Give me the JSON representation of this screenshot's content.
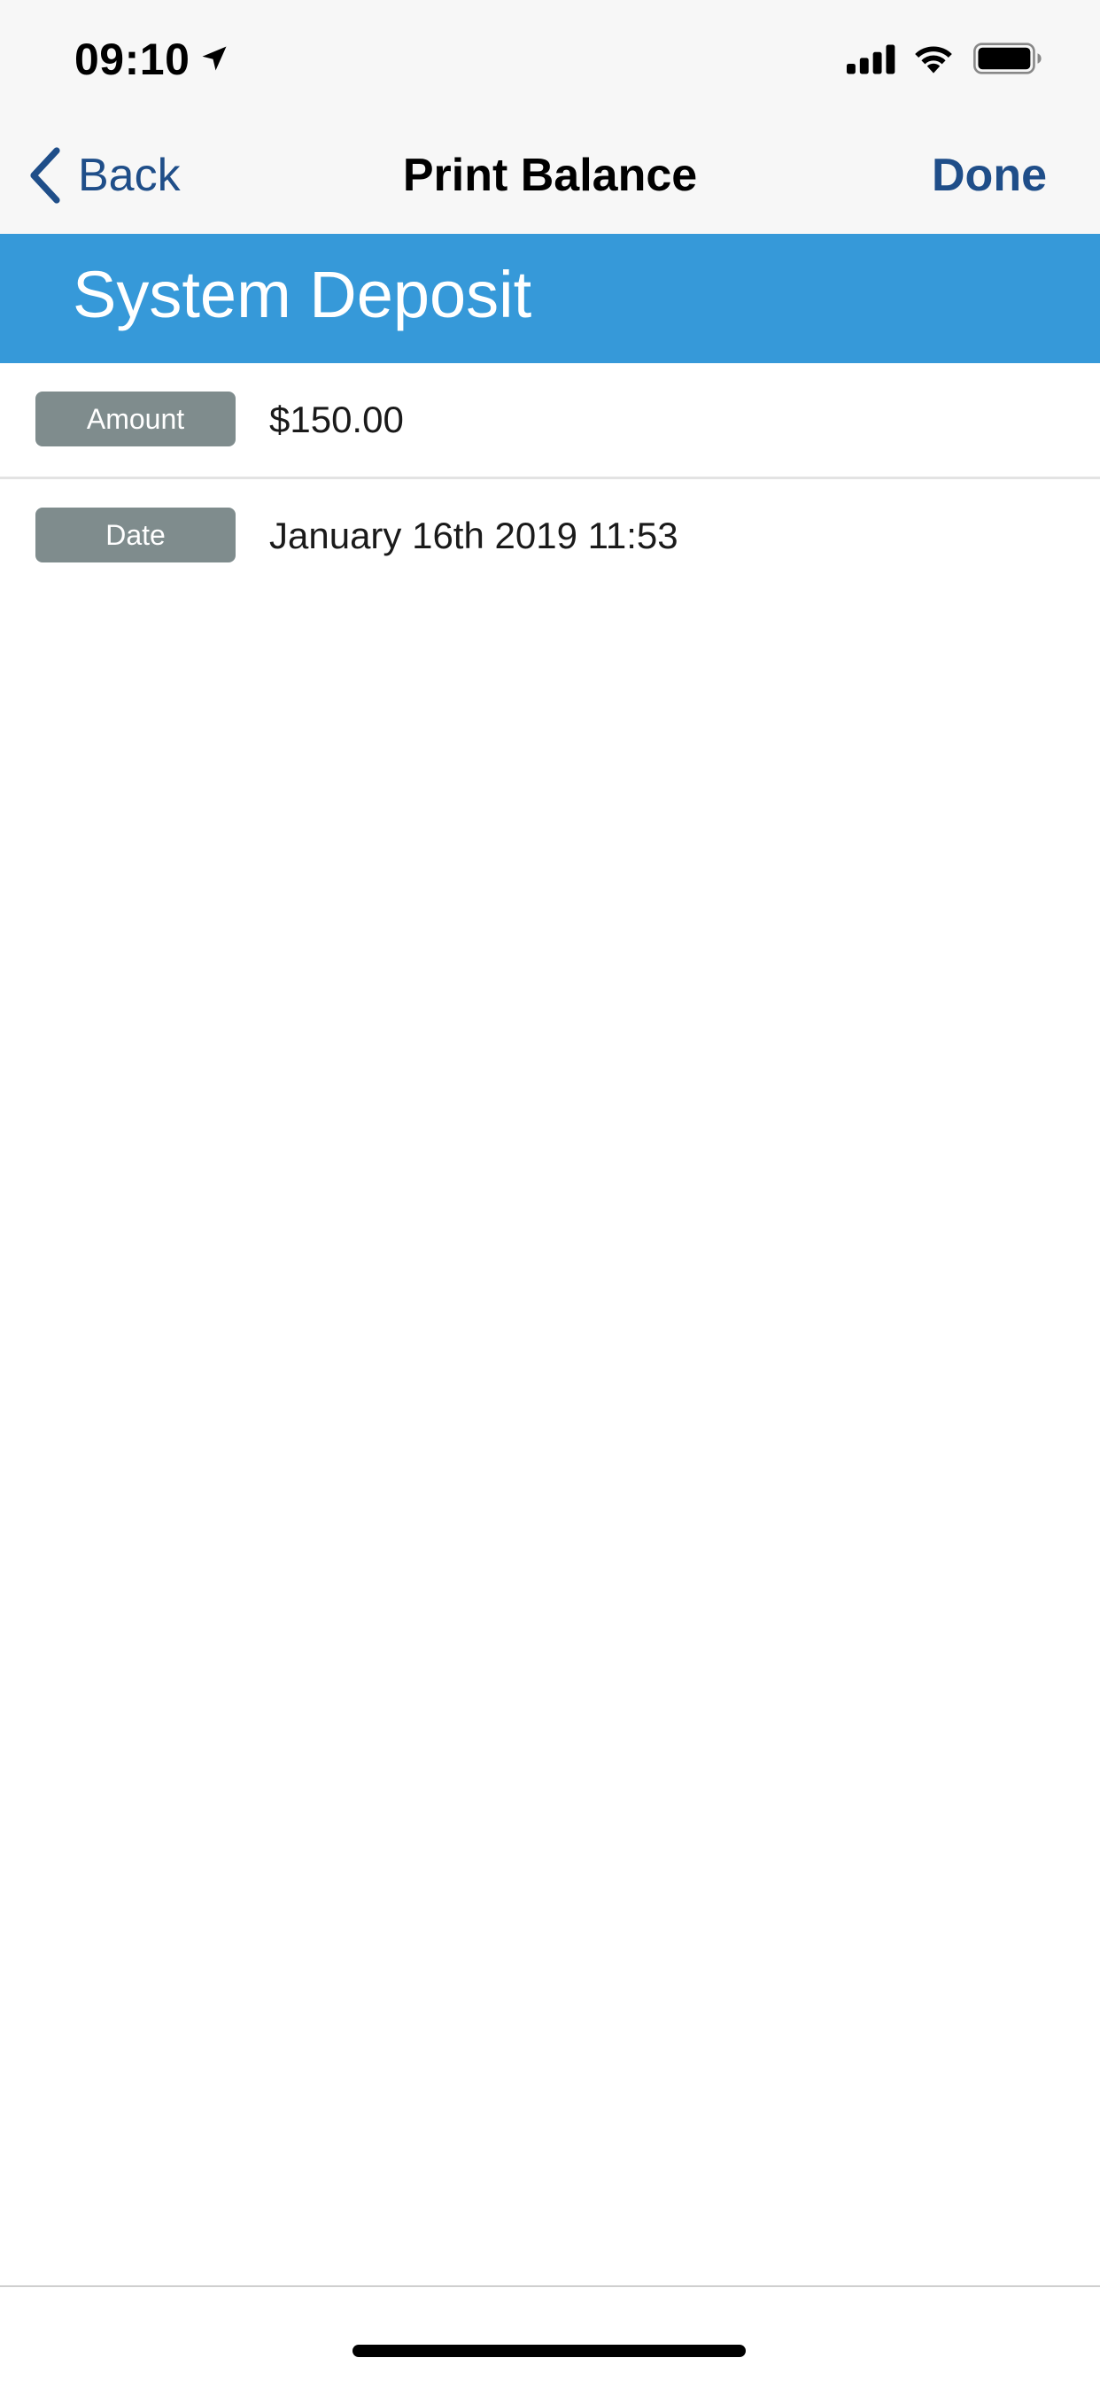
{
  "status_bar": {
    "time": "09:10",
    "icons": [
      "location-arrow-icon",
      "cellular-signal-icon",
      "wifi-icon",
      "battery-icon"
    ]
  },
  "nav": {
    "back_label": "Back",
    "title": "Print Balance",
    "done_label": "Done"
  },
  "section": {
    "title": "System Deposit"
  },
  "details": [
    {
      "label": "Amount",
      "value": "$150.00"
    },
    {
      "label": "Date",
      "value": "January 16th 2019 11:53"
    }
  ],
  "colors": {
    "nav_accent": "#1f4e89",
    "section_header_bg": "#3699d9",
    "badge_bg": "#7f8c8d",
    "chrome_bg": "#f7f7f7"
  }
}
